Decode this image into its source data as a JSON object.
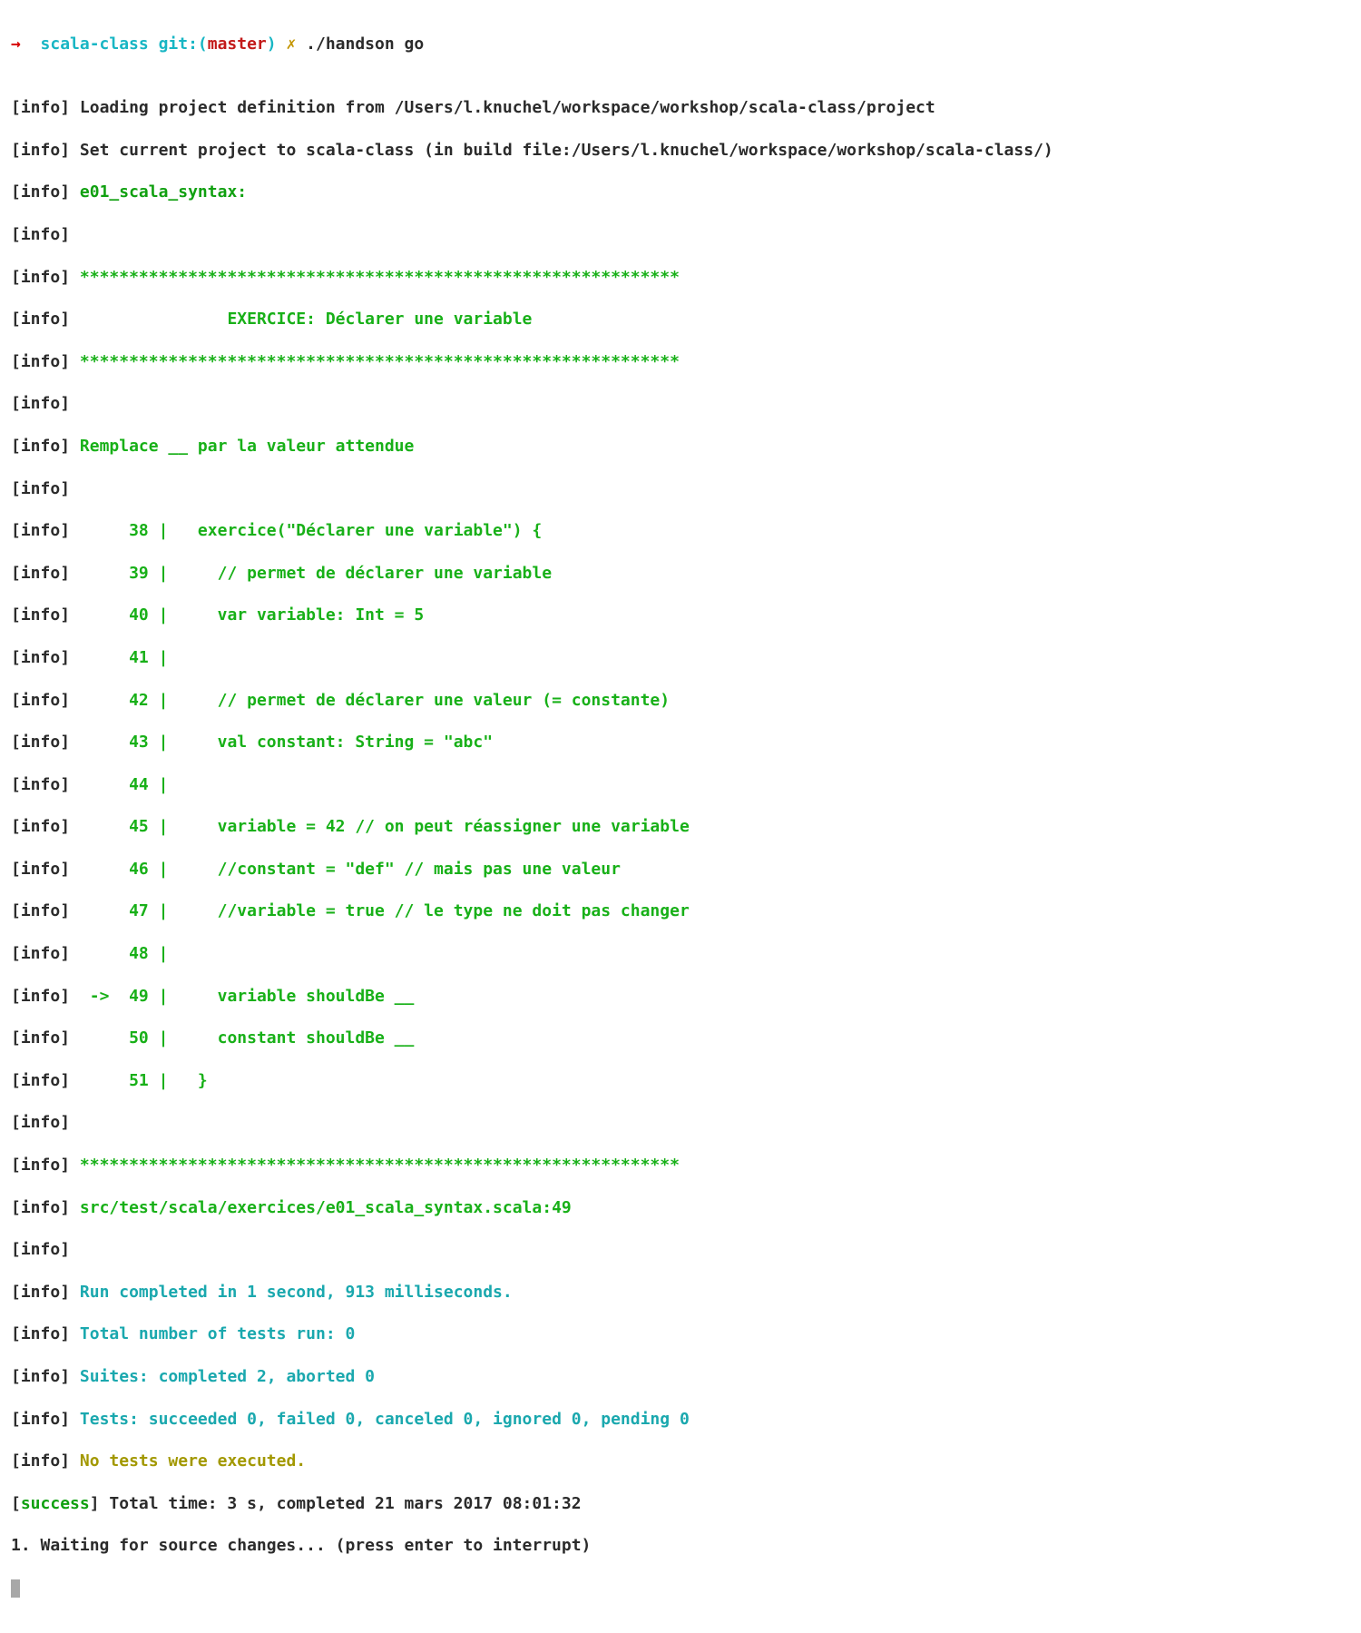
{
  "prompt": {
    "arrow": "→  ",
    "dir": "scala-class ",
    "git_prefix": "git:(",
    "branch": "master",
    "git_suffix": ") ",
    "dirty": "✗ ",
    "command": "./handson go"
  },
  "blank": "",
  "tag_info_open": "[",
  "tag_info_word": "info",
  "tag_info_close": "] ",
  "tag_success_open": "[",
  "tag_success_word": "success",
  "tag_success_close": "] ",
  "msg": {
    "load": "Loading project definition from /Users/l.knuchel/workspace/workshop/scala-class/project",
    "set": "Set current project to scala-class (in build file:/Users/l.knuchel/workspace/workshop/scala-class/)",
    "suite": "e01_scala_syntax:",
    "stars": "*************************************************************",
    "ex_title": "               EXERCICE: Déclarer une variable",
    "replace": "Remplace __ par la valeur attendue",
    "l38": "     38 |   exercice(\"Déclarer une variable\") {",
    "l39": "     39 |     // permet de déclarer une variable",
    "l40": "     40 |     var variable: Int = 5",
    "l41": "     41 |",
    "l42": "     42 |     // permet de déclarer une valeur (= constante)",
    "l43": "     43 |     val constant: String = \"abc\"",
    "l44": "     44 |",
    "l45": "     45 |     variable = 42 // on peut réassigner une variable",
    "l46": "     46 |     //constant = \"def\" // mais pas une valeur",
    "l47": "     47 |     //variable = true // le type ne doit pas changer",
    "l48": "     48 |",
    "l49": " ->  49 |     variable shouldBe __",
    "l50": "     50 |     constant shouldBe __",
    "l51": "     51 |   }",
    "srcfile": "src/test/scala/exercices/e01_scala_syntax.scala:49",
    "run_done": "Run completed in 1 second, 913 milliseconds.",
    "total_tests": "Total number of tests run: 0",
    "suites_line": "Suites: completed 2, aborted 0",
    "tests_line": "Tests: succeeded 0, failed 0, canceled 0, ignored 0, pending 0",
    "no_tests": "No tests were executed.",
    "total_time": "Total time: 3 s, completed 21 mars 2017 08:01:32",
    "waiting": "1. Waiting for source changes... (press enter to interrupt)"
  }
}
